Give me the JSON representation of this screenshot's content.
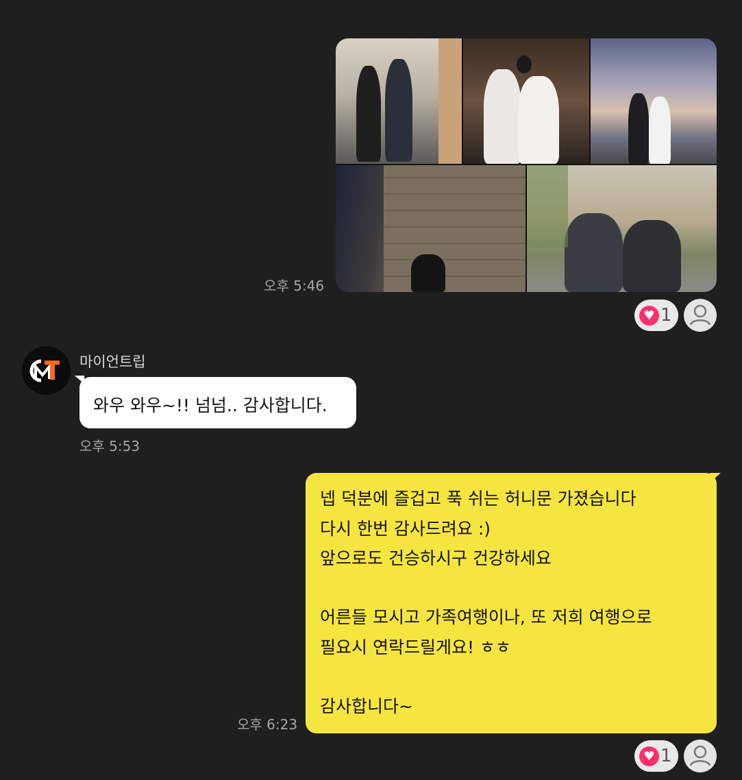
{
  "messages": {
    "photo_time": "오후 5:46",
    "photo_reaction_count": "1",
    "partner": {
      "name": "마이언트립",
      "text": "와우 와우~!! 넘넘.. 감사합니다.",
      "time": "오후 5:53"
    },
    "mine": {
      "lines": [
        "넵 덕분에 즐겁고 푹 쉬는 허니문 가졌습니다",
        "다시 한번 감사드려요 :)",
        "앞으로도 건승하시구 건강하세요",
        "어른들 모시고 가족여행이나, 또 저희 여행으로",
        "필요시 연락드릴게요! ㅎㅎ",
        "감사합니다~"
      ],
      "time": "오후 6:23",
      "reaction_count": "1"
    }
  },
  "icons": {
    "reaction": "heart-icon",
    "reader": "person-icon",
    "logo": "mit-logo"
  },
  "colors": {
    "background": "#1f1f1f",
    "my_bubble": "#f7e53f",
    "partner_bubble": "#ffffff",
    "heart": "#ff2f6e",
    "logo_orange": "#ff6a1a"
  }
}
